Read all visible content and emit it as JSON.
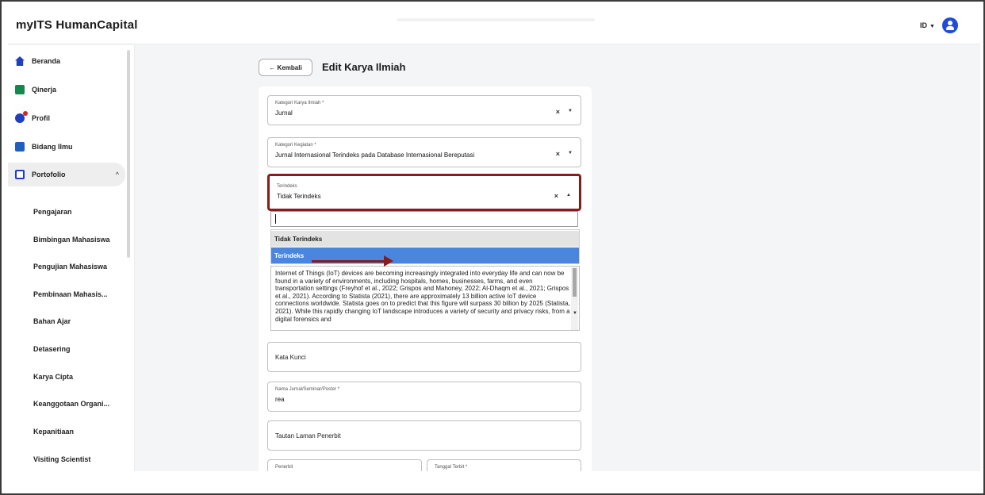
{
  "app": {
    "brand": "myITS HumanCapital",
    "lang": "ID"
  },
  "sidebar": {
    "items": [
      {
        "label": "Beranda"
      },
      {
        "label": "Qinerja"
      },
      {
        "label": "Profil"
      },
      {
        "label": "Bidang Ilmu"
      },
      {
        "label": "Portofolio"
      }
    ],
    "subitems": [
      "Pengajaran",
      "Bimbingan Mahasiswa",
      "Pengujian Mahasiswa",
      "Pembinaan Mahasis...",
      "Bahan Ajar",
      "Detasering",
      "Karya Cipta",
      "Keanggotaan Organi...",
      "Kepanitiaan",
      "Visiting Scientist"
    ]
  },
  "header": {
    "back_label": "← Kembali",
    "title": "Edit Karya Ilmiah"
  },
  "form": {
    "kategori": {
      "label": "Kategori Karya Ilmiah *",
      "value": "Jurnal"
    },
    "kegiatan": {
      "label": "Kategori Kegiatan *",
      "value": "Jurnal Internasional Terindeks pada Database Internasional Bereputasi"
    },
    "terindeks": {
      "label": "Terindeks",
      "value": "Tidak Terindeks"
    },
    "dropdown_options": [
      "Tidak Terindeks",
      "Terindeks"
    ],
    "abstract": "Internet of Things (IoT) devices are becoming increasingly integrated into everyday life and can now be found in a variety of environments, including hospitals, homes, businesses, farms, and even transportation settings (Freyhof et al., 2022; Grispos and Mahoney, 2022; Al-Dhaqm et al., 2021; Grispos et al., 2021). According to Statista (2021), there are approximately 13 billion active IoT device connections worldwide. Statista goes on to predict that this figure will surpass 30 billion by 2025 (Statista, 2021). While this rapidly changing IoT landscape introduces a variety of security and privacy risks, from a digital forensics and",
    "kata_kunci": {
      "placeholder": "Kata Kunci"
    },
    "nama_jurnal": {
      "label": "Nama Jurnal/Seminar/Poster *",
      "value": "rea"
    },
    "tautan": {
      "placeholder": "Tautan Laman Penerbit"
    },
    "penerbit": {
      "label": "Penerbit"
    },
    "tanggal": {
      "label": "Tanggal Terbit *"
    }
  },
  "icons": {
    "clear": "×",
    "caret_down": "▼",
    "caret_up": "▲",
    "chevron_up": "^"
  },
  "colors": {
    "highlight_border": "#8b1a1a",
    "selected_option": "#4a86dd",
    "brand_blue": "#1f3fbf"
  }
}
